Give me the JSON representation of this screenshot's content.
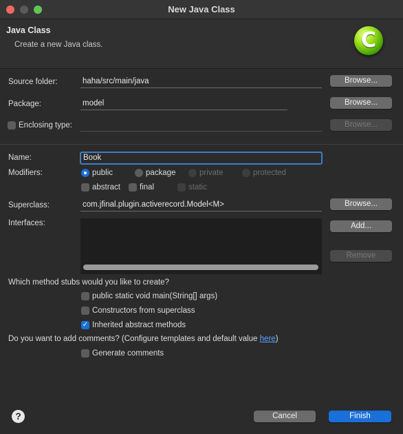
{
  "window": {
    "title": "New Java Class"
  },
  "header": {
    "title": "Java Class",
    "description": "Create a new Java class.",
    "logo_letter": "C"
  },
  "form": {
    "source_folder": {
      "label": "Source folder:",
      "value": "haha/src/main/java",
      "browse": "Browse..."
    },
    "package": {
      "label": "Package:",
      "value": "model",
      "browse": "Browse..."
    },
    "enclosing_type": {
      "label": "Enclosing type:",
      "value": "",
      "browse": "Browse...",
      "checked": false
    },
    "name": {
      "label": "Name:",
      "value": "Book"
    },
    "modifiers": {
      "label": "Modifiers:",
      "access": [
        {
          "label": "public",
          "selected": true,
          "enabled": true
        },
        {
          "label": "package",
          "selected": false,
          "enabled": true
        },
        {
          "label": "private",
          "selected": false,
          "enabled": false
        },
        {
          "label": "protected",
          "selected": false,
          "enabled": false
        }
      ],
      "flags": [
        {
          "label": "abstract",
          "checked": false,
          "enabled": true
        },
        {
          "label": "final",
          "checked": false,
          "enabled": true
        },
        {
          "label": "static",
          "checked": false,
          "enabled": false
        }
      ]
    },
    "superclass": {
      "label": "Superclass:",
      "value": "com.jfinal.plugin.activerecord.Model<M>",
      "browse": "Browse..."
    },
    "interfaces": {
      "label": "Interfaces:",
      "add": "Add...",
      "remove": "Remove"
    }
  },
  "stubs": {
    "question": "Which method stubs would you like to create?",
    "options": [
      {
        "label": "public static void main(String[] args)",
        "checked": false
      },
      {
        "label": "Constructors from superclass",
        "checked": false
      },
      {
        "label": "Inherited abstract methods",
        "checked": true
      }
    ]
  },
  "comments": {
    "question": "Do you want to add comments? (Configure templates and default value ",
    "link": "here",
    "question_end": ")",
    "option": {
      "label": "Generate comments",
      "checked": false
    }
  },
  "footer": {
    "help": "?",
    "cancel": "Cancel",
    "finish": "Finish"
  },
  "colors": {
    "accent": "#1b6fd8",
    "close": "#ed6a5e",
    "minimize": "#5a5a5a",
    "maximize": "#61c554",
    "logo": "#8fd620",
    "link": "#5aa8ff"
  },
  "icons": [
    "close-traffic-light",
    "minimize-traffic-light",
    "maximize-traffic-light",
    "java-class-logo-icon",
    "help-icon",
    "checkmark-icon"
  ]
}
